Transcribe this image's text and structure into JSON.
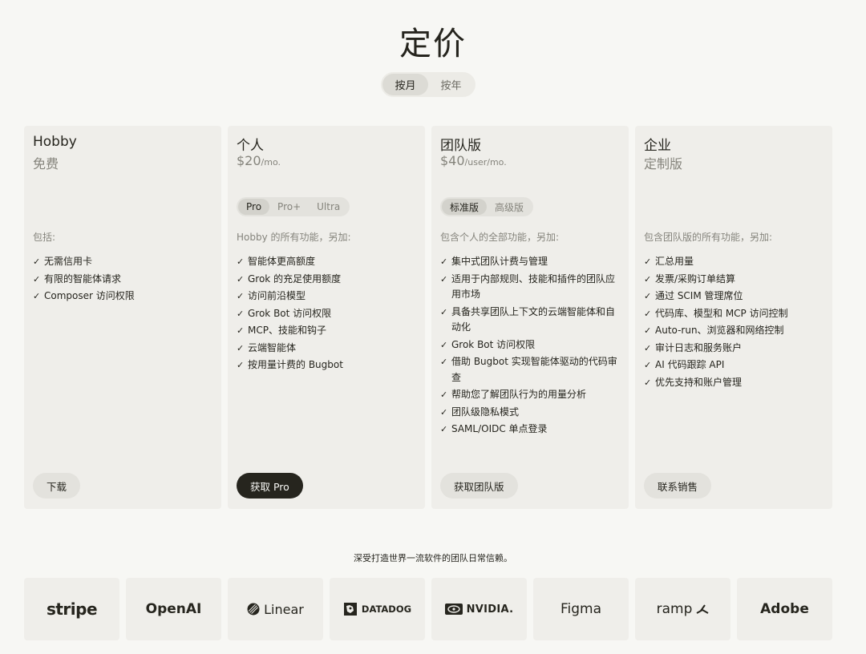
{
  "header": {
    "title": "定价"
  },
  "billing": {
    "monthly": "按月",
    "yearly": "按年",
    "selected": "按月"
  },
  "plans": [
    {
      "name": "Hobby",
      "price": "免费",
      "unit": "",
      "includes": "包括:",
      "features": [
        "无需信用卡",
        "有限的智能体请求",
        "Composer 访问权限"
      ],
      "cta": "下载"
    },
    {
      "name": "个人",
      "price": "$20",
      "unit": "/mo.",
      "tiers": [
        "Pro",
        "Pro+",
        "Ultra"
      ],
      "selected_tier": "Pro",
      "includes": "Hobby 的所有功能，另加:",
      "features": [
        "智能体更高额度",
        "Grok 的充足使用额度",
        "访问前沿模型",
        "Grok Bot 访问权限",
        "MCP、技能和钩子",
        "云端智能体",
        "按用量计费的 Bugbot"
      ],
      "cta": "获取 Pro"
    },
    {
      "name": "团队版",
      "price": "$40",
      "unit": "/user/mo.",
      "tiers": [
        "标准版",
        "高级版"
      ],
      "selected_tier": "标准版",
      "includes": "包含个人的全部功能，另加:",
      "features": [
        "集中式团队计费与管理",
        "适用于内部规则、技能和插件的团队应用市场",
        "具备共享团队上下文的云端智能体和自动化",
        "Grok Bot 访问权限",
        "借助 Bugbot 实现智能体驱动的代码审查",
        "帮助您了解团队行为的用量分析",
        "团队级隐私模式",
        "SAML/OIDC 单点登录"
      ],
      "cta": "获取团队版"
    },
    {
      "name": "企业",
      "price": "定制版",
      "unit": "",
      "includes": "包含团队版的所有功能，另加:",
      "features": [
        "汇总用量",
        "发票/采购订单结算",
        "通过 SCIM 管理席位",
        "代码库、模型和 MCP 访问控制",
        "Auto-run、浏览器和网络控制",
        "审计日志和服务账户",
        "AI 代码跟踪 API",
        "优先支持和账户管理"
      ],
      "cta": "联系销售"
    }
  ],
  "check_glyph": "✓",
  "trust": {
    "text": "深受打造世界一流软件的团队日常信赖。"
  },
  "logos": [
    "stripe",
    "OpenAI",
    "Linear",
    "DATADOG",
    "NVIDIA.",
    "Figma",
    "ramp",
    "Adobe"
  ],
  "colors": {
    "background": "#f7f7f4",
    "card": "#efeeea",
    "text": "#26251e",
    "muted": "#85847c",
    "primary_button": "#26251e"
  }
}
